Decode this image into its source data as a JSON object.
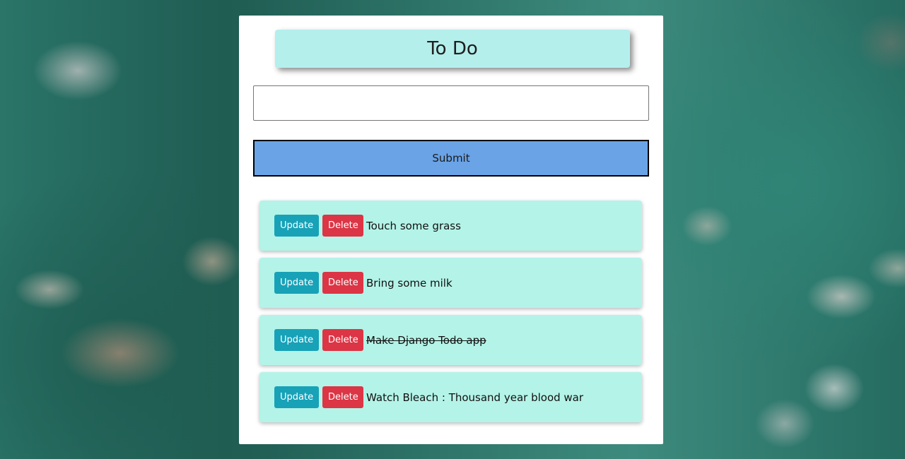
{
  "header": {
    "title": "To Do"
  },
  "form": {
    "input_value": "",
    "input_placeholder": "",
    "submit_label": "Submit"
  },
  "todos": [
    {
      "text": "Touch some grass",
      "completed": false,
      "update_label": "Update",
      "delete_label": "Delete"
    },
    {
      "text": "Bring some milk",
      "completed": false,
      "update_label": "Update",
      "delete_label": "Delete"
    },
    {
      "text": "Make Django Todo app",
      "completed": true,
      "update_label": "Update",
      "delete_label": "Delete"
    },
    {
      "text": "Watch Bleach : Thousand year blood war",
      "completed": false,
      "update_label": "Update",
      "delete_label": "Delete"
    }
  ],
  "colors": {
    "title_bg": "#b4efec",
    "submit_bg": "#6aa3e6",
    "item_bg": "#b4f3e8",
    "update_btn": "#17a2b8",
    "delete_btn": "#dc3545"
  }
}
